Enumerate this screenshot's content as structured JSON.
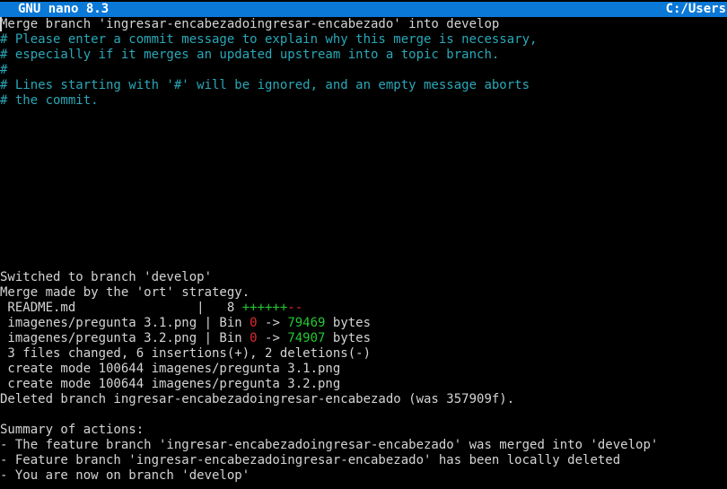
{
  "titlebar": {
    "app": "GNU nano 8.3",
    "path": "C:/Users"
  },
  "editor": {
    "lines": [
      "Merge branch 'ingresar-encabezadoingresar-encabezado' into develop",
      "# Please enter a commit message to explain why this merge is necessary,",
      "# especially if it merges an updated upstream into a topic branch.",
      "#",
      "# Lines starting with '#' will be ignored, and an empty message aborts",
      "# the commit."
    ]
  },
  "output": {
    "switched": "Switched to branch 'develop'",
    "merge_strategy": "Merge made by the 'ort' strategy.",
    "readme": {
      "name": " README.md                |   8 ",
      "plus": "++++++",
      "minus": "--"
    },
    "file1": {
      "name": " imagenes/pregunta 3.1.png | Bin ",
      "old": "0",
      "arrow": " -> ",
      "new": "79469",
      "unit": " bytes"
    },
    "file2": {
      "name": " imagenes/pregunta 3.2.png | Bin ",
      "old": "0",
      "arrow": " -> ",
      "new": "74907",
      "unit": " bytes"
    },
    "summary_stat": " 3 files changed, 6 insertions(+), 2 deletions(-)",
    "create1": " create mode 100644 imagenes/pregunta 3.1.png",
    "create2": " create mode 100644 imagenes/pregunta 3.2.png",
    "deleted": "Deleted branch ingresar-encabezadoingresar-encabezado (was 357909f).",
    "summary_title": "Summary of actions:",
    "summary_items": [
      "- The feature branch 'ingresar-encabezadoingresar-encabezado' was merged into 'develop'",
      "- Feature branch 'ingresar-encabezadoingresar-encabezado' has been locally deleted",
      "- You are now on branch 'develop'"
    ]
  },
  "colors": {
    "titlebar_bg": "#0a78d7",
    "comment": "#2aa8b8",
    "insertions": "#23c833",
    "deletions": "#e02a2a"
  }
}
